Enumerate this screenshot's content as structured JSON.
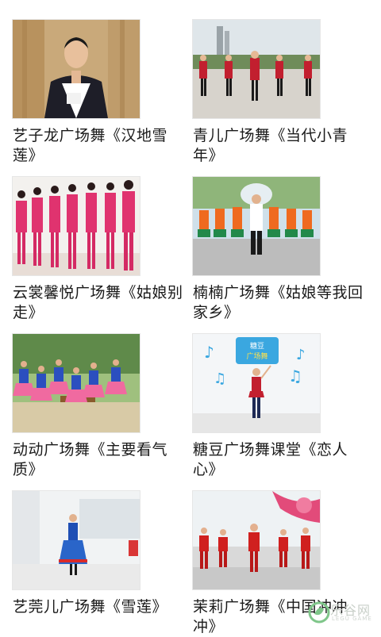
{
  "videos": [
    {
      "title": "艺子龙广场舞《汉地雪莲》"
    },
    {
      "title": "青儿广场舞《当代小青年》"
    },
    {
      "title": "云裳馨悦广场舞《姑娘别走》"
    },
    {
      "title": "楠楠广场舞《姑娘等我回家乡》"
    },
    {
      "title": "动动广场舞《主要看气质》"
    },
    {
      "title": "糖豆广场舞课堂《恋人心》"
    },
    {
      "title": "艺莞儿广场舞《雪莲》"
    },
    {
      "title": "茉莉广场舞《中国冲冲冲》"
    }
  ],
  "thumbnails": {
    "dance_show_logo": "糖豆 广场舞"
  },
  "watermark": {
    "logo": "乐谷网",
    "sub": "LEGU GAME"
  }
}
